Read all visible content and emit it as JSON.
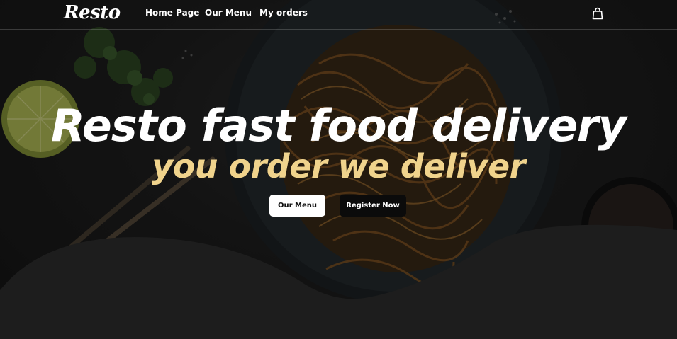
{
  "nav": {
    "logo": "Resto",
    "links": [
      "Home Page",
      "Our Menu",
      "My orders"
    ],
    "cart_icon": "shopping-bag-icon"
  },
  "hero": {
    "headline": "Resto fast food delivery",
    "subheadline": "you order we deliver",
    "primary_button": "Our Menu",
    "secondary_button": "Register Now"
  },
  "colors": {
    "headline": "#ffffff",
    "subheadline": "#f0d38c",
    "primary_button_bg": "#ffffff",
    "secondary_button_bg": "#0b0b0b",
    "page_bg": "#1d1d1d"
  }
}
